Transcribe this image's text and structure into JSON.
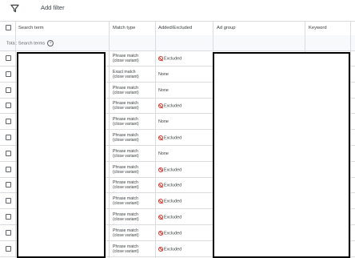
{
  "filter": {
    "add_label": "Add filter",
    "icon": "filter-icon"
  },
  "table": {
    "columns": [
      {
        "key": "search_term",
        "label": "Search term"
      },
      {
        "key": "match_type",
        "label": "Match type"
      },
      {
        "key": "added_excluded",
        "label": "Added/Excluded"
      },
      {
        "key": "ad_group",
        "label": "Ad group"
      },
      {
        "key": "keyword",
        "label": "Keyword"
      }
    ],
    "totals_label": "Total: Search terms",
    "rows": [
      {
        "match": [
          "Phrase match",
          "(close variant)"
        ],
        "status": "Excluded"
      },
      {
        "match": [
          "Exact match",
          "(close variant)"
        ],
        "status": "None"
      },
      {
        "match": [
          "Phrase match",
          "(close variant)"
        ],
        "status": "None"
      },
      {
        "match": [
          "Phrase match",
          "(close variant)"
        ],
        "status": "Excluded"
      },
      {
        "match": [
          "Phrase match",
          "(close variant)"
        ],
        "status": "None"
      },
      {
        "match": [
          "Phrase match",
          "(close variant)"
        ],
        "status": "Excluded"
      },
      {
        "match": [
          "Phrase match",
          "(close variant)"
        ],
        "status": "None"
      },
      {
        "match": [
          "Phrase match",
          "(close variant)"
        ],
        "status": "Excluded"
      },
      {
        "match": [
          "Phrase match",
          "(close variant)"
        ],
        "status": "Excluded"
      },
      {
        "match": [
          "Phrase match",
          "(close variant)"
        ],
        "status": "Excluded"
      },
      {
        "match": [
          "Phrase match",
          "(close variant)"
        ],
        "status": "Excluded"
      },
      {
        "match": [
          "Phrase match",
          "(close variant)"
        ],
        "status": "Excluded"
      },
      {
        "match": [
          "Phrase match",
          "(close variant)"
        ],
        "status": "Excluded"
      }
    ]
  },
  "colors": {
    "excluded_icon": "#d93025",
    "border": "#dadce0",
    "text": "#3c4043"
  }
}
